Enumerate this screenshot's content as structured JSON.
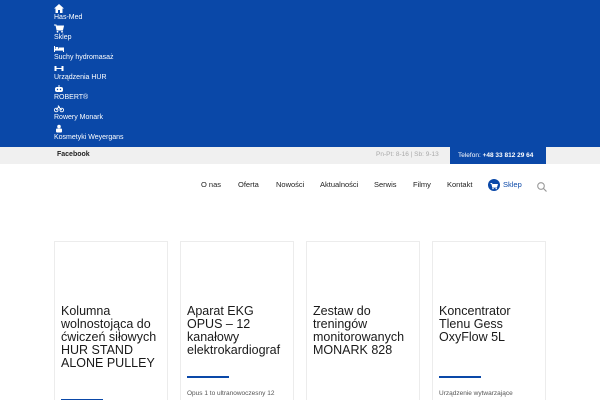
{
  "topbar": {
    "background": "#0a48a8",
    "items": [
      {
        "icon": "home-icon",
        "label": "Has-Med"
      },
      {
        "icon": "cart-icon",
        "label": "Sklep"
      },
      {
        "icon": "bed-icon",
        "label": "Suchy hydromasaż"
      },
      {
        "icon": "dumbbell-icon",
        "label": "Urządzenia HUR"
      },
      {
        "icon": "robot-icon",
        "label": "ROBERT®"
      },
      {
        "icon": "bicycle-icon",
        "label": "Rowery Monark"
      },
      {
        "icon": "cosmetics-icon",
        "label": "Kosmetyki Weyergans"
      }
    ]
  },
  "infobar": {
    "facebook": "Facebook",
    "hours": "Pn-Pt: 8-16 | Sb: 9-13",
    "phone_label": "Telefon:",
    "phone_number": "+48 33 812 29 64"
  },
  "nav": {
    "items": [
      "O nas",
      "Oferta",
      "Nowości",
      "Aktualności",
      "Serwis",
      "Filmy",
      "Kontakt"
    ],
    "shop_label": "Sklep",
    "shop_icon": "cart-icon",
    "search_icon": "search-icon"
  },
  "cards": [
    {
      "title": "Kolumna wolnostojąca do ćwiczeń siłowych HUR STAND ALONE PULLEY",
      "desc": ""
    },
    {
      "title": "Aparat EKG OPUS – 12 kanałowy elektrokardiograf",
      "desc": "Opus 1 to ultranowoczesny 12"
    },
    {
      "title": "Zestaw do treningów monitorowanych MONARK 828",
      "desc": ""
    },
    {
      "title": "Koncentrator Tlenu Gess OxyFlow 5L",
      "desc": "Urządzenie wytwarzające"
    }
  ],
  "colors": {
    "accent": "#0a48a8",
    "infobar": "#f0f0f0",
    "text": "#222222"
  }
}
